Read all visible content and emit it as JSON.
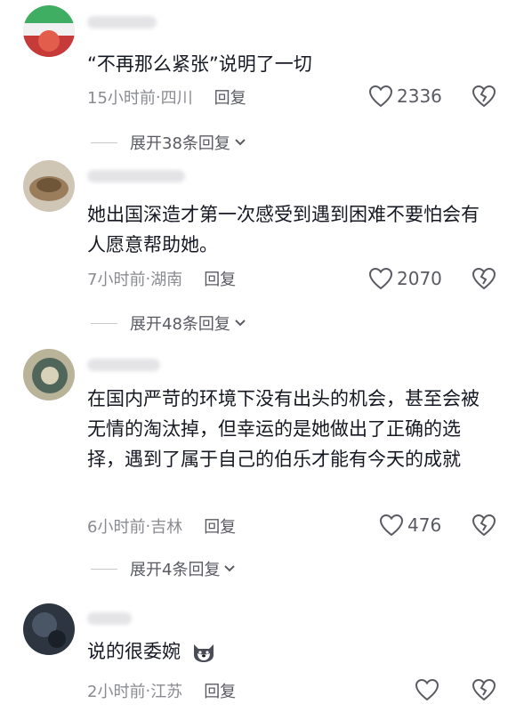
{
  "comments": [
    {
      "text": "“不再那么紧张”说明了一切",
      "time": "15小时前",
      "location": "四川",
      "reply_label": "回复",
      "likes": "2336",
      "expand_label": "展开38条回复"
    },
    {
      "text": "她出国深造才第一次感受到遇到困难不要怕会有人愿意帮助她。",
      "time": "7小时前",
      "location": "湖南",
      "reply_label": "回复",
      "likes": "2070",
      "expand_label": "展开48条回复"
    },
    {
      "text": "在国内严苛的环境下没有出头的机会，甚至会被无情的淘汰掉，但幸运的是她做出了正确的选择，遇到了属于自己的伯乐才能有今天的成就",
      "time": "6小时前",
      "location": "吉林",
      "reply_label": "回复",
      "likes": "476",
      "expand_label": "展开4条回复"
    },
    {
      "text": "说的很委婉",
      "time": "2小时前",
      "location": "江苏",
      "reply_label": "回复",
      "likes": ""
    }
  ],
  "meta_separator": " · ",
  "colors": {
    "text": "#161823",
    "meta": "#8a8b91",
    "icon": "#5a5b62"
  }
}
